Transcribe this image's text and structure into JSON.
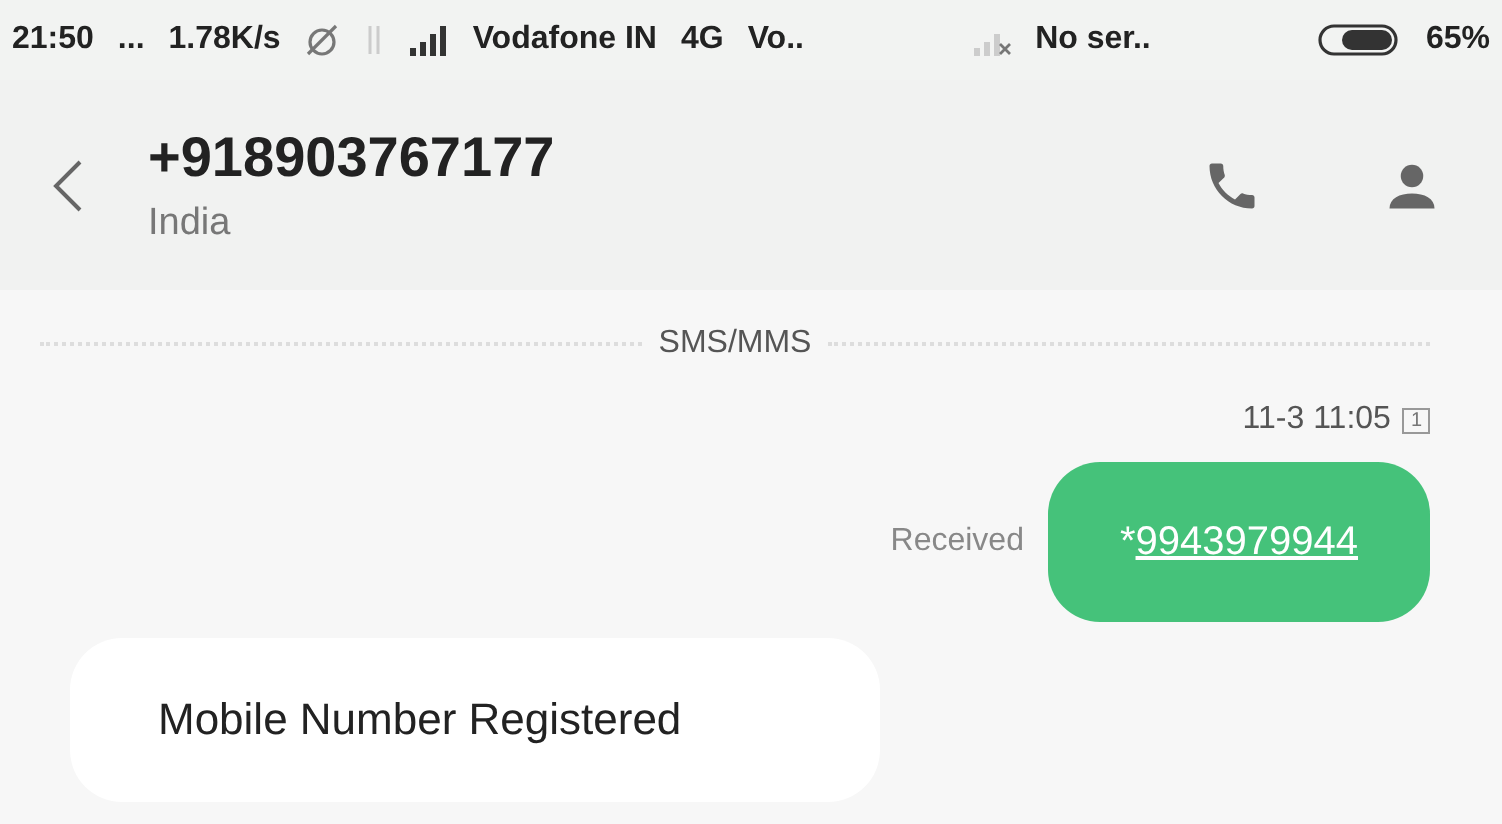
{
  "status_bar": {
    "time": "21:50",
    "dots": "...",
    "speed": "1.78K/s",
    "carrier_1": "Vodafone IN",
    "network": "4G",
    "carrier_1_extra": "Vo..",
    "carrier_2": "No ser..",
    "battery": "65%"
  },
  "header": {
    "title": "+918903767177",
    "subtitle": "India"
  },
  "divider": "SMS/MMS",
  "messages": [
    {
      "kind": "timestamp",
      "text": "11-3 11:05",
      "sim": "1"
    },
    {
      "kind": "sent",
      "status": "Received",
      "prefix": "*",
      "link": "9943979944"
    },
    {
      "kind": "incoming",
      "text": "Mobile Number Registered"
    }
  ]
}
